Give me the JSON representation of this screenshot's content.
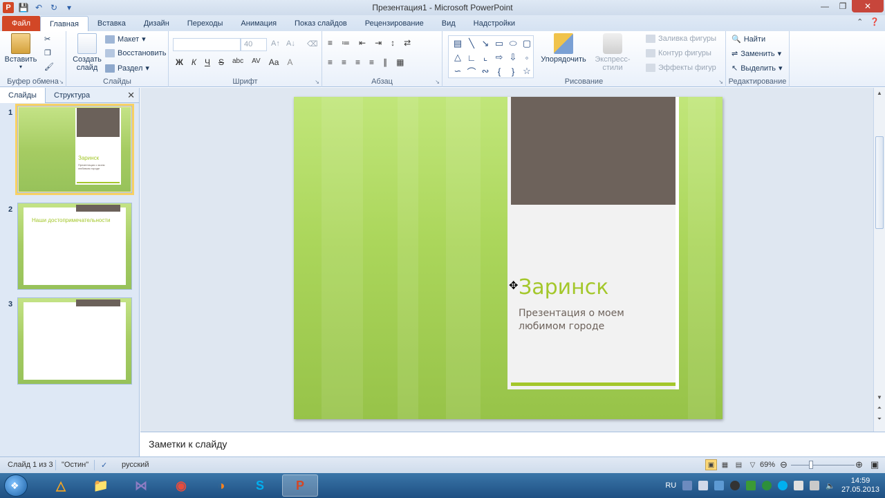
{
  "titlebar": {
    "title": "Презентация1  -  Microsoft PowerPoint",
    "app_icon": "P",
    "qat": [
      "save-icon",
      "undo-icon",
      "redo-icon",
      "customize-icon"
    ],
    "controls": [
      "minimize-icon",
      "restore-icon",
      "close-icon"
    ]
  },
  "tabs": [
    {
      "label": "Файл"
    },
    {
      "label": "Главная"
    },
    {
      "label": "Вставка"
    },
    {
      "label": "Дизайн"
    },
    {
      "label": "Переходы"
    },
    {
      "label": "Анимация"
    },
    {
      "label": "Показ слайдов"
    },
    {
      "label": "Рецензирование"
    },
    {
      "label": "Вид"
    },
    {
      "label": "Надстройки"
    }
  ],
  "ribbon": {
    "clipboard": {
      "label": "Буфер обмена",
      "paste": "Вставить"
    },
    "slides": {
      "label": "Слайды",
      "new_slide": "Создать слайд",
      "layout": "Макет",
      "reset": "Восстановить",
      "section": "Раздел"
    },
    "font": {
      "label": "Шрифт",
      "font_name": "",
      "font_size": "40",
      "bold": "Ж",
      "italic": "К",
      "underline": "Ч",
      "strike": "S",
      "shadow": "abc",
      "spacing": "AV",
      "case": "Aa",
      "grow": "A",
      "shrink": "A"
    },
    "paragraph": {
      "label": "Абзац"
    },
    "drawing": {
      "label": "Рисование",
      "arrange": "Упорядочить",
      "quick_styles": "Экспресс-стили",
      "fill": "Заливка фигуры",
      "outline": "Контур фигуры",
      "effects": "Эффекты фигур"
    },
    "editing": {
      "label": "Редактирование",
      "find": "Найти",
      "replace": "Заменить",
      "select": "Выделить"
    }
  },
  "left_panel": {
    "tabs": [
      "Слайды",
      "Структура"
    ],
    "thumbs": [
      {
        "num": "1",
        "title": "Заринск",
        "sub": "Презентация о моем любимом городе"
      },
      {
        "num": "2",
        "title": "Наши достопримечательности"
      },
      {
        "num": "3",
        "title": ""
      }
    ]
  },
  "slide": {
    "title": "Заринск",
    "subtitle": "Презентация о моем любимом городе",
    "colors": {
      "bg": "#abd65b",
      "card": "#f2f2f2",
      "dark": "#6d625b",
      "accent": "#a4c72b"
    }
  },
  "notes": {
    "placeholder": "Заметки к слайду"
  },
  "statusbar": {
    "slide_info": "Слайд 1 из 3",
    "theme": "\"Остин\"",
    "language": "русский",
    "zoom": "69%"
  },
  "taskbar": {
    "apps": [
      "avast-icon",
      "explorer-icon",
      "visual-studio-icon",
      "chrome-icon",
      "firefox-icon",
      "skype-icon",
      "powerpoint-icon"
    ],
    "lang": "RU",
    "time": "14:59",
    "date": "27.05.2013"
  }
}
